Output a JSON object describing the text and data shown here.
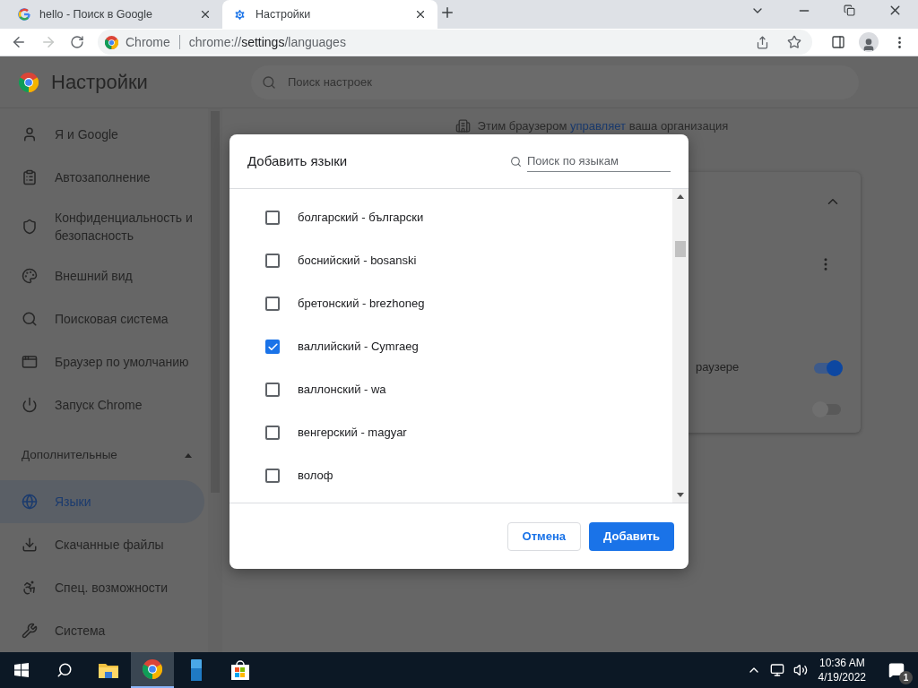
{
  "tabs": [
    {
      "title": "hello - Поиск в Google",
      "kind": "google",
      "selected": false
    },
    {
      "title": "Настройки",
      "kind": "settings",
      "selected": true
    }
  ],
  "toolbar": {
    "forward_disabled": true,
    "site_label": "Chrome",
    "url_prefix": "chrome://",
    "url_host": "settings",
    "url_path": "/languages"
  },
  "settings": {
    "title": "Настройки",
    "search_placeholder": "Поиск настроек",
    "sidebar": [
      {
        "label": "Я и Google",
        "selected": false
      },
      {
        "label": "Автозаполнение",
        "selected": false
      },
      {
        "label": "Конфиденциальность и безопасность",
        "selected": false
      },
      {
        "label": "Внешний вид",
        "selected": false
      },
      {
        "label": "Поисковая система",
        "selected": false
      },
      {
        "label": "Браузер по умолчанию",
        "selected": false
      },
      {
        "label": "Запуск Chrome",
        "selected": false
      }
    ],
    "advanced": {
      "label": "Дополнительные",
      "expanded": true,
      "items": [
        {
          "label": "Языки",
          "selected": true
        },
        {
          "label": "Скачанные файлы",
          "selected": false
        },
        {
          "label": "Спец. возможности",
          "selected": false
        },
        {
          "label": "Система",
          "selected": false
        }
      ]
    },
    "managed_notice": {
      "before": "Этим браузером ",
      "link": "управляет",
      "after": " ваша организация"
    },
    "card": {
      "expanded": true,
      "visible_text": "раузере",
      "toggles": [
        {
          "on": true
        },
        {
          "on": false
        }
      ]
    }
  },
  "dialog": {
    "title": "Добавить языки",
    "search_placeholder": "Поиск по языкам",
    "languages": [
      {
        "label": "болгарский - български",
        "checked": false
      },
      {
        "label": "боснийский - bosanski",
        "checked": false
      },
      {
        "label": "бретонский - brezhoneg",
        "checked": false
      },
      {
        "label": "валлийский - Cymraeg",
        "checked": true
      },
      {
        "label": "валлонский - wa",
        "checked": false
      },
      {
        "label": "венгерский - magyar",
        "checked": false
      },
      {
        "label": "волоф",
        "checked": false
      }
    ],
    "cancel": "Отмена",
    "confirm": "Добавить"
  },
  "taskbar": {
    "time": "10:36 AM",
    "date": "4/19/2022",
    "notifications": "1"
  }
}
